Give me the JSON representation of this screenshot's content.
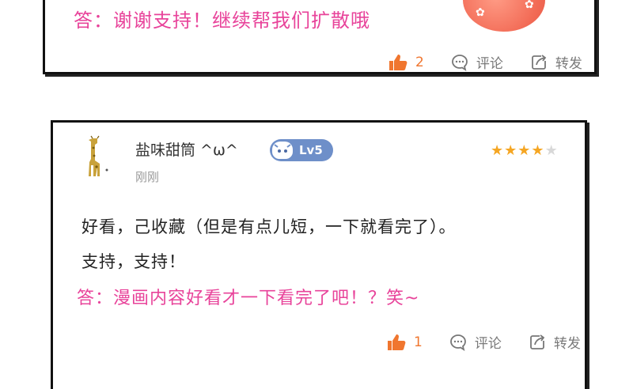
{
  "card1": {
    "reply": "答：谢谢支持！继续帮我们扩散哦",
    "actions": {
      "like_count": "2",
      "comment": "评论",
      "share": "转发"
    }
  },
  "card2": {
    "username": "盐味甜筒 ^ω^",
    "level": "Lv5",
    "timestamp": "刚刚",
    "rating": {
      "filled": 4,
      "total": 5
    },
    "comment_lines": [
      "好看，己收藏（但是有点儿短，一下就看完了）。",
      "支持，支持！"
    ],
    "reply": "答：漫画内容好看才一下看完了吧！？笑~",
    "actions": {
      "like_count": "1",
      "comment": "评论",
      "share": "转发"
    }
  },
  "colors": {
    "reply": "#e8439a",
    "like": "#f0762f",
    "badge": "#6e8fc9",
    "star": "#f5a623"
  },
  "icons": {
    "like": "thumbs-up-icon",
    "comment": "speech-bubble-icon",
    "share": "share-icon"
  }
}
